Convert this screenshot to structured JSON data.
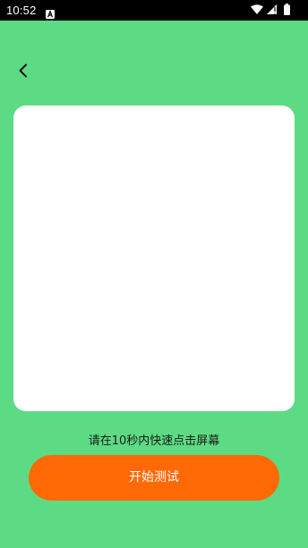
{
  "status_bar": {
    "time": "10:52",
    "icons": [
      "notification-a-icon",
      "wifi-icon",
      "cellular-icon",
      "battery-icon"
    ]
  },
  "nav": {
    "back_icon": "chevron-left-icon"
  },
  "hint_text": "请在10秒内快速点击屏幕",
  "start_button_label": "开始测试",
  "colors": {
    "background": "#5DDB84",
    "card": "#FFFFFF",
    "button": "#FF6A06",
    "button_text": "#FFFFFF"
  }
}
